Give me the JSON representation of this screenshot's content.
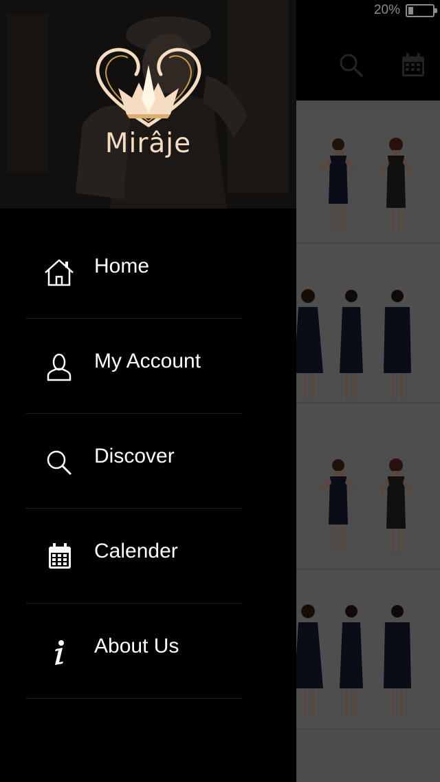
{
  "status_bar": {
    "battery_text": "20%",
    "battery_level": 0.2
  },
  "drawer": {
    "logo_text": "Mirâje",
    "menu": [
      {
        "label": "Home",
        "icon": "home-icon"
      },
      {
        "label": "My Account",
        "icon": "user-icon"
      },
      {
        "label": "Discover",
        "icon": "search-icon"
      },
      {
        "label": "Calender",
        "icon": "calendar-icon"
      },
      {
        "label": "About Us",
        "icon": "info-icon"
      }
    ]
  },
  "header": {
    "icons": [
      "search-icon",
      "calendar-icon"
    ]
  },
  "colors": {
    "accent_gold": "#f6dcc0",
    "drawer_bg": "#000000",
    "dress_navy": "#1c2340"
  }
}
